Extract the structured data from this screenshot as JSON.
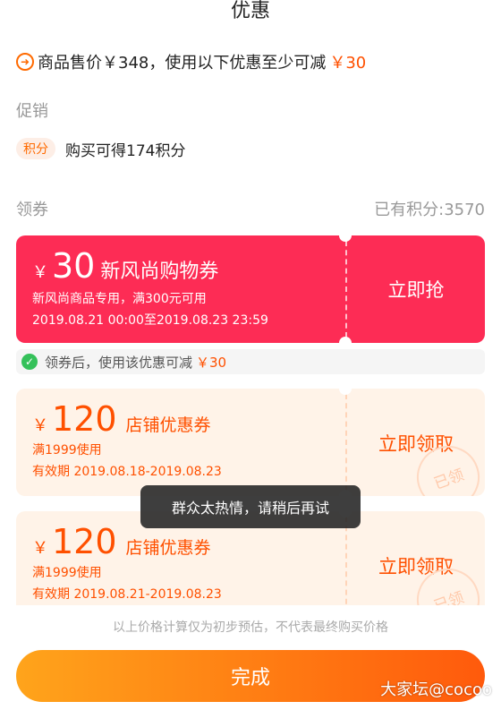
{
  "title": "优惠",
  "price_line": {
    "text": "商品售价￥348，使用以下优惠至少可减",
    "amount": "￥30",
    "icon": "arrow-circle-icon"
  },
  "promo": {
    "label": "促销",
    "tag": "积分",
    "text": "购买可得174积分"
  },
  "coupons_header": {
    "label": "领券",
    "owned_points": "已有积分:3570"
  },
  "coupon_main": {
    "yen": "￥",
    "amount": "30",
    "name": "新风尚购物券",
    "desc": "新风尚商品专用，满300元可用",
    "validity": "2019.08.21 00:00至2019.08.23 23:59",
    "action": "立即抢"
  },
  "coupon_tip": {
    "text": "领券后，使用该优惠可减",
    "amount": "￥30"
  },
  "store_coupons": [
    {
      "yen": "￥",
      "amount": "120",
      "name": "店铺优惠券",
      "condition": "满1999使用",
      "validity": "有效期 2019.08.18-2019.08.23",
      "action": "立即领取",
      "stamp": "已领"
    },
    {
      "yen": "￥",
      "amount": "120",
      "name": "店铺优惠券",
      "condition": "满1999使用",
      "validity": "有效期 2019.08.21-2019.08.23",
      "action": "立即领取",
      "stamp": "已领"
    }
  ],
  "toast": "群众太热情，请稍后再试",
  "disclaimer": "以上价格计算仅为初步预估，不代表最终购买价格",
  "done_button": "完成",
  "watermark": "大家坛@cocoo",
  "colors": {
    "accent": "#ff5000",
    "coupon_red": "#fd2c55",
    "coupon_light": "#fff3e8",
    "button_start": "#ffa41b",
    "button_end": "#ff5a0c"
  }
}
